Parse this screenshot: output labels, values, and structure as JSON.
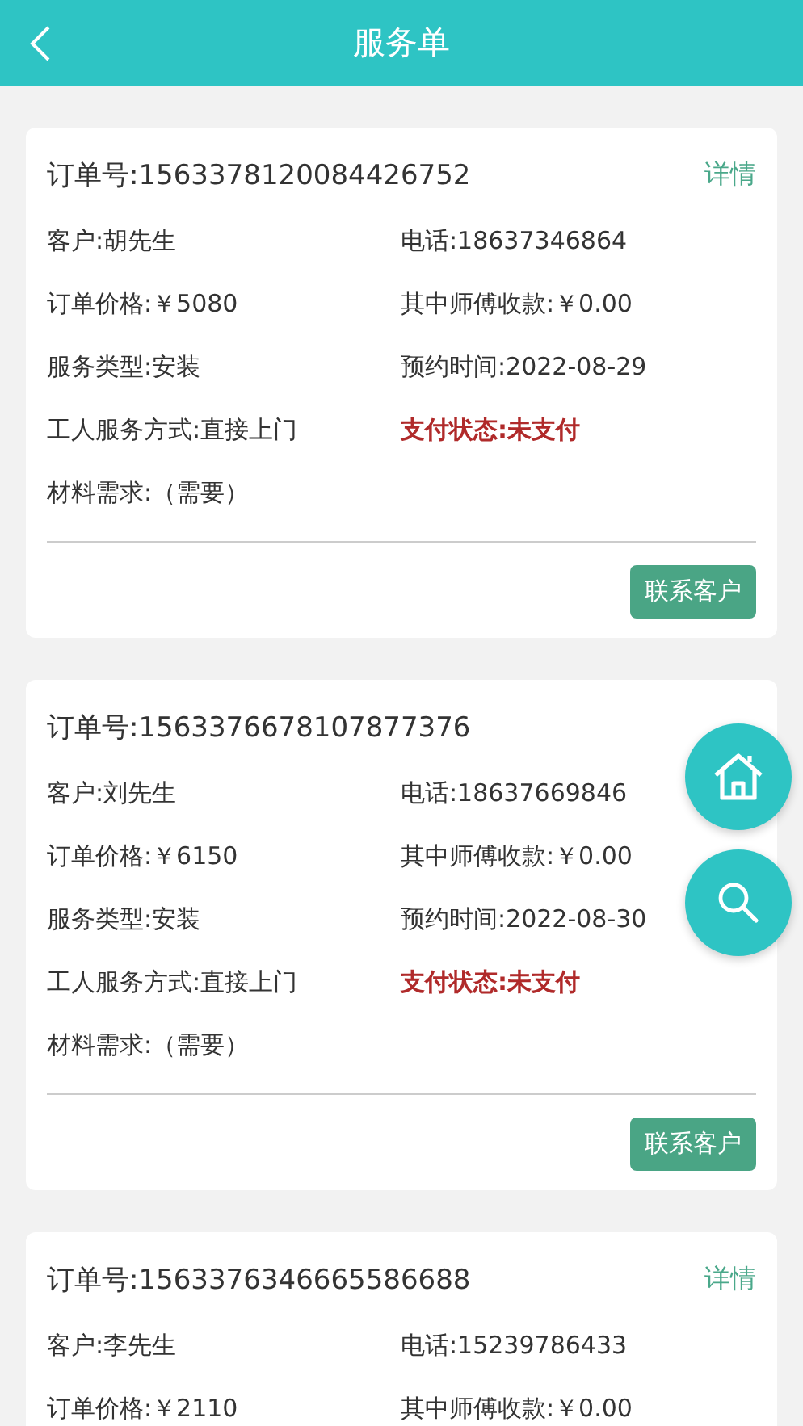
{
  "header": {
    "title": "服务单"
  },
  "orders": [
    {
      "order_no": "订单号:1563378120084426752",
      "detail": "详情",
      "rows": [
        [
          {
            "text": "客户:胡先生",
            "kind": "plain"
          },
          {
            "text": "电话:18637346864",
            "kind": "plain"
          }
        ],
        [
          {
            "text": "订单价格:￥5080",
            "kind": "plain"
          },
          {
            "text": "其中师傅收款:￥0.00",
            "kind": "plain"
          }
        ],
        [
          {
            "text": "服务类型:安装",
            "kind": "plain"
          },
          {
            "text": "预约时间:2022-08-29",
            "kind": "plain"
          }
        ],
        [
          {
            "text": "工人服务方式:直接上门",
            "kind": "plain"
          },
          {
            "text": "支付状态:未支付",
            "kind": "alert"
          }
        ],
        [
          {
            "text": "材料需求:（需要）",
            "kind": "plain"
          }
        ]
      ],
      "button": "联系客户"
    },
    {
      "order_no": "订单号:1563376678107877376",
      "rows": [
        [
          {
            "text": "客户:刘先生",
            "kind": "plain"
          },
          {
            "text": "电话:18637669846",
            "kind": "plain"
          }
        ],
        [
          {
            "text": "订单价格:￥6150",
            "kind": "plain"
          },
          {
            "text": "其中师傅收款:￥0.00",
            "kind": "plain"
          }
        ],
        [
          {
            "text": "服务类型:安装",
            "kind": "plain"
          },
          {
            "text": "预约时间:2022-08-30",
            "kind": "plain"
          }
        ],
        [
          {
            "text": "工人服务方式:直接上门",
            "kind": "plain"
          },
          {
            "text": "支付状态:未支付",
            "kind": "alert"
          }
        ],
        [
          {
            "text": "材料需求:（需要）",
            "kind": "plain"
          }
        ]
      ],
      "button": "联系客户"
    },
    {
      "order_no": "订单号:1563376346665586688",
      "detail": "详情",
      "rows": [
        [
          {
            "text": "客户:李先生",
            "kind": "plain"
          },
          {
            "text": "电话:15239786433",
            "kind": "plain"
          }
        ],
        [
          {
            "text": "订单价格:￥2110",
            "kind": "plain"
          },
          {
            "text": "其中师傅收款:￥0.00",
            "kind": "plain"
          }
        ]
      ]
    }
  ]
}
